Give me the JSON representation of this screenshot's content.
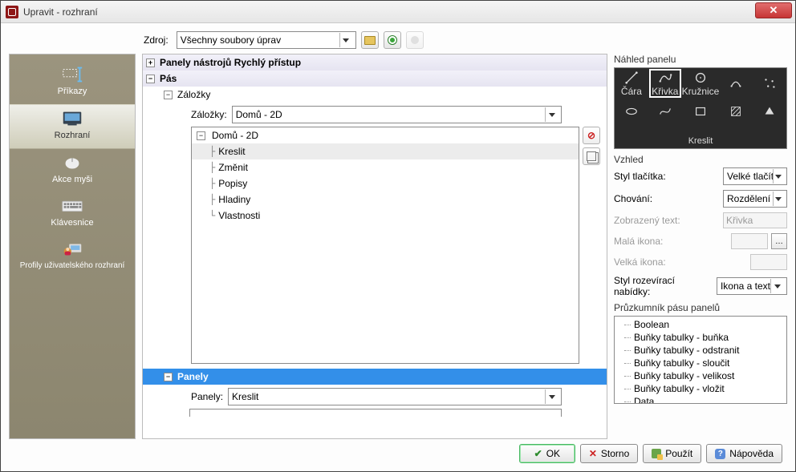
{
  "window": {
    "title": "Upravit - rozhraní"
  },
  "source": {
    "label": "Zdroj:",
    "value": "Všechny soubory úprav"
  },
  "sidebar": {
    "items": [
      {
        "label": "Příkazy"
      },
      {
        "label": "Rozhraní"
      },
      {
        "label": "Akce myši"
      },
      {
        "label": "Klávesnice"
      },
      {
        "label": "Profily uživatelského rozhraní"
      }
    ]
  },
  "tree": {
    "qa_panels": "Panely nástrojů Rychlý přístup",
    "ribbon": "Pás",
    "tabs_label": "Záložky",
    "tabs_field_label": "Záložky:",
    "tabs_field_value": "Domů - 2D",
    "tab_root": "Domů - 2D",
    "tab_items": [
      "Kreslit",
      "Změnit",
      "Popisy",
      "Hladiny",
      "Vlastnosti"
    ],
    "panels": "Panely",
    "panels_field_label": "Panely:",
    "panels_field_value": "Kreslit"
  },
  "preview": {
    "title": "Náhled panelu",
    "cells": [
      "Čára",
      "Křivka",
      "Kružnice",
      "",
      ""
    ],
    "row_bottom_1": "",
    "row_bottom_2": "",
    "group_label": "Kreslit"
  },
  "appearance": {
    "title": "Vzhled",
    "button_style_label": "Styl tlačítka:",
    "button_style_value": "Velké tlačítko",
    "behavior_label": "Chování:",
    "behavior_value": "Rozdělení s p",
    "text_label": "Zobrazený text:",
    "text_value": "Křivka",
    "small_icon_label": "Malá ikona:",
    "large_icon_label": "Velká ikona:",
    "dropdown_style_label": "Styl rozevírací nabídky:",
    "dropdown_style_value": "Ikona a text"
  },
  "explorer": {
    "title": "Průzkumník pásu panelů",
    "items": [
      "Boolean",
      "Buňky tabulky - buňka",
      "Buňky tabulky - odstranit",
      "Buňky tabulky - sloučit",
      "Buňky tabulky - velikost",
      "Buňky tabulky - vložit",
      "Data"
    ]
  },
  "footer": {
    "ok": "OK",
    "cancel": "Storno",
    "apply": "Použít",
    "help": "Nápověda"
  }
}
